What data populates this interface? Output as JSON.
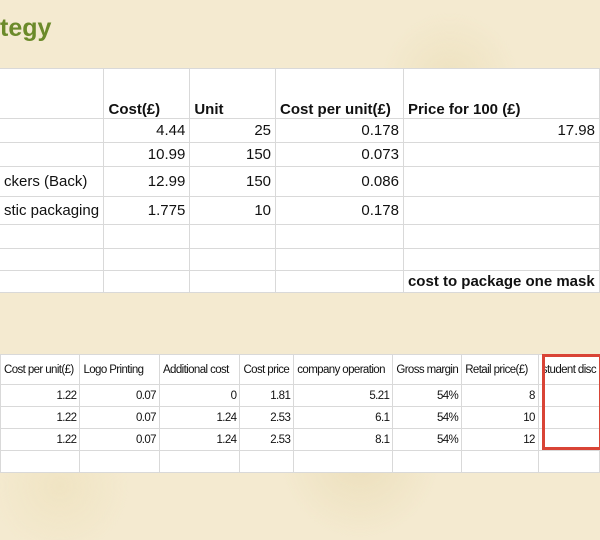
{
  "title": "tegy",
  "table1": {
    "headers": [
      "",
      "Cost(£)",
      "Unit",
      "Cost per unit(£)",
      "Price for 100 (£)"
    ],
    "rows": [
      [
        "",
        "4.44",
        "25",
        "0.178",
        "17.98"
      ],
      [
        "",
        "10.99",
        "150",
        "0.073",
        ""
      ],
      [
        "ckers (Back)",
        "12.99",
        "150",
        "0.086",
        ""
      ],
      [
        "stic packaging",
        "1.775",
        "10",
        "0.178",
        ""
      ],
      [
        "",
        "",
        "",
        "",
        ""
      ],
      [
        "",
        "",
        "",
        "",
        ""
      ],
      [
        "",
        "",
        "",
        "",
        "cost to package one mask"
      ]
    ]
  },
  "table2": {
    "headers": [
      "Cost per unit(£)",
      "Logo Printing",
      "Additional cost",
      "Cost price",
      "company operation",
      "Gross margin",
      "Retail price(£)",
      "student disc"
    ],
    "rows": [
      [
        "1.22",
        "0.07",
        "0",
        "1.81",
        "5.21",
        "54%",
        "8",
        ""
      ],
      [
        "1.22",
        "0.07",
        "1.24",
        "2.53",
        "6.1",
        "54%",
        "10",
        ""
      ],
      [
        "1.22",
        "0.07",
        "1.24",
        "2.53",
        "8.1",
        "54%",
        "12",
        ""
      ],
      [
        "",
        "",
        "",
        "",
        "",
        "",
        "",
        ""
      ]
    ]
  },
  "colors": {
    "title": "#6b8a2a",
    "highlight": "#d94436"
  }
}
